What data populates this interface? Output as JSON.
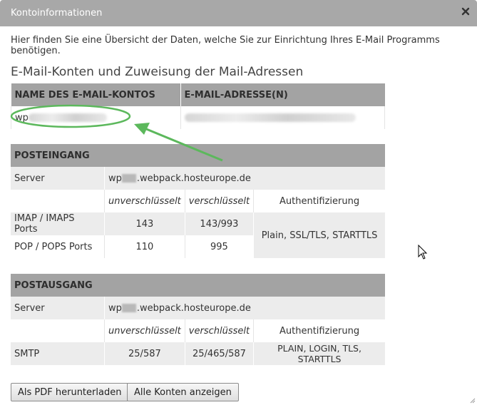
{
  "dialog": {
    "title": "Kontoinformationen",
    "close_icon": "close-icon",
    "intro": "Hier finden Sie eine Übersicht der Daten, welche Sie zur Einrichtung Ihres E-Mail Programms benötigen.",
    "accounts_title": "E-Mail-Konten und Zuweisung der Mail-Adressen"
  },
  "accounts": {
    "headers": [
      "NAME DES E-MAIL-KONTOS",
      "E-MAIL-ADRESSE(N)"
    ],
    "account_prefix": "wp"
  },
  "incoming": {
    "title": "POSTEINGANG",
    "server_label": "Server",
    "server_prefix": "wp",
    "server_suffix": ".webpack.hosteurope.de",
    "col_unencrypted": "unverschlüsselt",
    "col_encrypted": "verschlüsselt",
    "col_auth": "Authentifizierung",
    "rows": [
      {
        "label": "IMAP / IMAPS Ports",
        "unencrypted": "143",
        "encrypted": "143/993"
      },
      {
        "label": "POP / POPS Ports",
        "unencrypted": "110",
        "encrypted": "995"
      }
    ],
    "auth": "Plain, SSL/TLS, STARTTLS"
  },
  "outgoing": {
    "title": "POSTAUSGANG",
    "server_label": "Server",
    "server_prefix": "wp",
    "server_suffix": ".webpack.hosteurope.de",
    "col_unencrypted": "unverschlüsselt",
    "col_encrypted": "verschlüsselt",
    "col_auth": "Authentifizierung",
    "smtp_label": "SMTP",
    "smtp_unencrypted": "25/587",
    "smtp_encrypted": "25/465/587",
    "smtp_auth": "PLAIN, LOGIN, TLS, STARTTLS"
  },
  "buttons": {
    "pdf": "Als PDF herunterladen",
    "all_accounts": "Alle Konten anzeigen"
  },
  "colors": {
    "titlebar": "#a8a8a8",
    "table_header": "#a3a3a3",
    "row_alt": "#ececec",
    "annotation": "#5cb85c"
  }
}
